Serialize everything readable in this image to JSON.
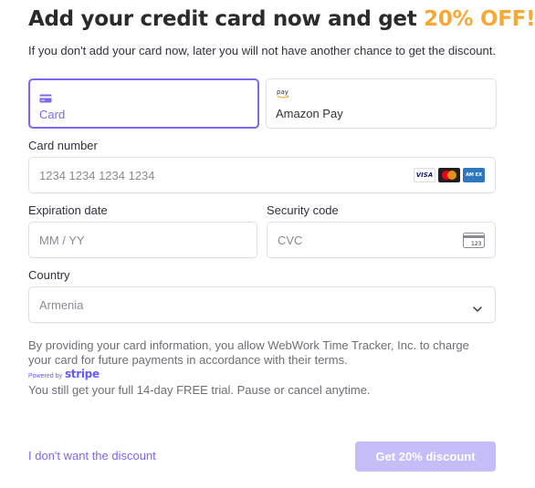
{
  "header": {
    "title": "Add your credit card now and get",
    "title_accent": "20% OFF!",
    "subtitle": "If you don't add your card now, later you will not have another chance to get the discount."
  },
  "payment_methods": [
    {
      "label": "Card",
      "icon": "credit-card-icon",
      "selected": true
    },
    {
      "label": "Amazon Pay",
      "icon": "amazon-pay-icon",
      "icon_text": "pay",
      "selected": false
    }
  ],
  "card_number": {
    "label": "Card number",
    "placeholder": "1234 1234 1234 1234",
    "brands": [
      {
        "name": "visa-icon",
        "text": "VISA"
      },
      {
        "name": "mastercard-icon"
      },
      {
        "name": "amex-icon",
        "text": "AM EX"
      }
    ]
  },
  "expiration": {
    "label": "Expiration date",
    "placeholder": "MM / YY"
  },
  "security_code": {
    "label": "Security code",
    "placeholder": "CVC",
    "icon_text": "123"
  },
  "country": {
    "label": "Country",
    "value": "Armenia"
  },
  "legal": {
    "text": "By providing your card information, you allow WebWork Time Tracker, Inc. to charge your card for future payments in accordance with their terms.",
    "powered_by": "Powered by",
    "stripe": "stripe",
    "trial": "You still get your full 14-day FREE trial. Pause or cancel anytime."
  },
  "actions": {
    "decline": "I don't want the discount",
    "accept": "Get 20% discount"
  },
  "colors": {
    "accent": "#f7a935",
    "primary": "#7b68ee",
    "button_disabled": "#c4bdf7",
    "stripe": "#635bff"
  }
}
